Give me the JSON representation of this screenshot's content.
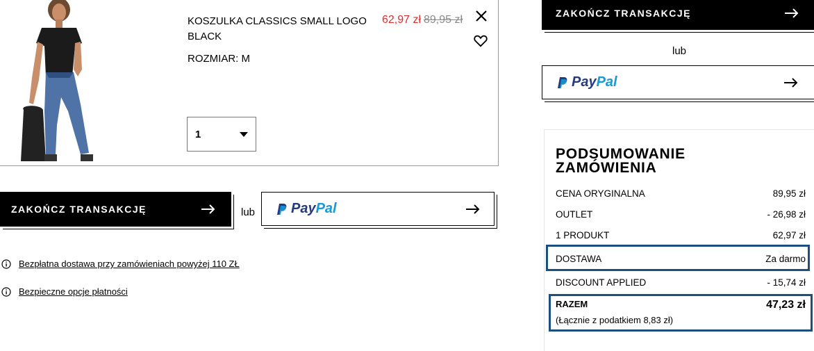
{
  "product": {
    "name": "KOSZULKA CLASSICS SMALL LOGO BLACK",
    "size": "ROZMIAR: M",
    "price_sale": "62,97 zł",
    "price_original": "89,95 zł",
    "quantity": "1"
  },
  "actions": {
    "checkout_label": "ZAKOŃCZ TRANSAKCJĘ",
    "or_label": "lub",
    "paypal_pay": "Pay",
    "paypal_pal": "Pal"
  },
  "info": {
    "free_shipping": "Bezpłatna dostawa przy zamówieniach powyżej 110 ZŁ",
    "secure_payment": "Bezpieczne opcje płatności"
  },
  "summary": {
    "title": "PODSUMOWANIE ZAMÓWIENIA",
    "rows": [
      {
        "label": "CENA ORYGINALNA",
        "value": "89,95 zł"
      },
      {
        "label": "OUTLET",
        "value": "- 26,98 zł"
      },
      {
        "label": "1 PRODUKT",
        "value": "62,97 zł"
      },
      {
        "label": "DOSTAWA",
        "value": "Za darmo"
      },
      {
        "label": "DISCOUNT APPLIED",
        "value": "- 15,74 zł"
      }
    ],
    "total_label": "RAZEM",
    "total_value": "47,23 zł",
    "tax_note": "(Łącznie z podatkiem  8,83 zł)"
  },
  "colors": {
    "sale": "#e32b2b",
    "highlight_border": "#1c4e80",
    "paypal_dark": "#253b80",
    "paypal_light": "#179bd7"
  },
  "icons": [
    "close-icon",
    "heart-icon",
    "caret-down-icon",
    "arrow-right-icon",
    "paypal-logo-icon",
    "info-icon"
  ]
}
